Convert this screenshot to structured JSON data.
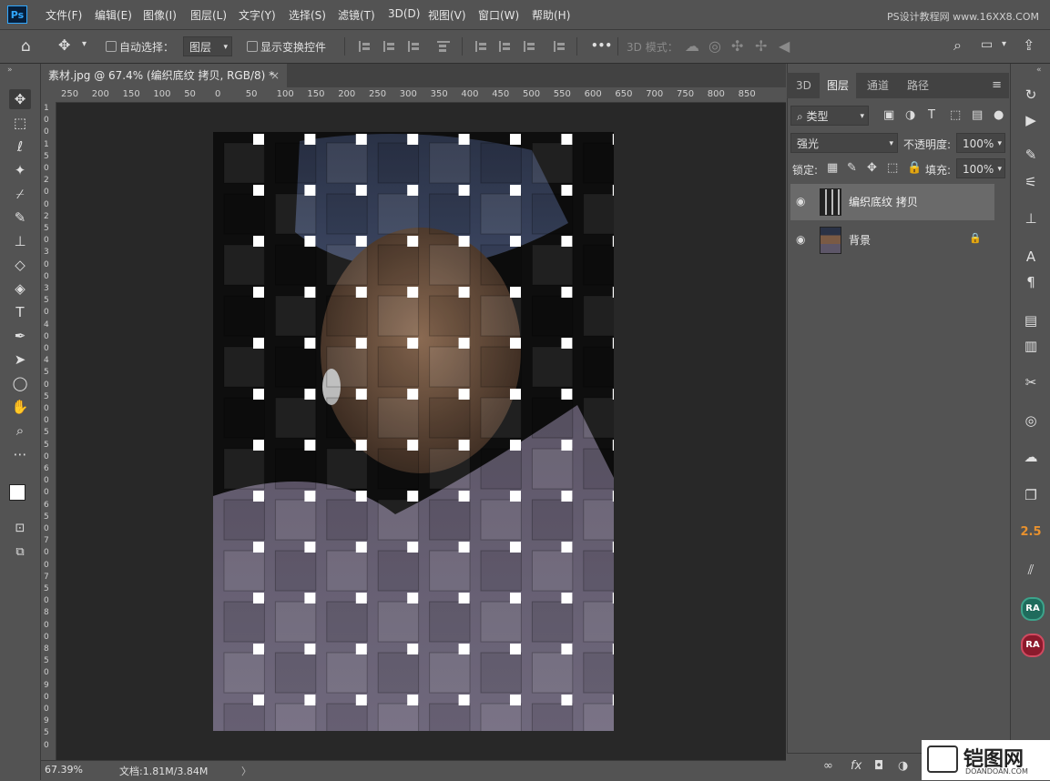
{
  "app": {
    "logo": "Ps",
    "watermark_top": "PS设计教程网  www.16XX8.COM"
  },
  "menu": [
    "文件(F)",
    "编辑(E)",
    "图像(I)",
    "图层(L)",
    "文字(Y)",
    "选择(S)",
    "滤镜(T)",
    "3D(D)",
    "视图(V)",
    "窗口(W)",
    "帮助(H)"
  ],
  "options": {
    "auto_select_label": "自动选择：",
    "auto_select_value": "图层",
    "show_transform_label": "显示变换控件",
    "more": "•••",
    "mode_3d_label": "3D 模式："
  },
  "document": {
    "tab_title": "素材.jpg @ 67.4% (编织底纹 拷贝, RGB/8) *",
    "close_glyph": "×",
    "ruler_h": [
      "250",
      "200",
      "150",
      "100",
      "50",
      "0",
      "50",
      "100",
      "150",
      "200",
      "250",
      "300",
      "350",
      "400",
      "450",
      "500",
      "550",
      "600",
      "650",
      "700",
      "750",
      "800",
      "850"
    ],
    "ruler_v": [
      "1",
      "0",
      "0",
      "1",
      "5",
      "0",
      "2",
      "0",
      "0",
      "2",
      "5",
      "0",
      "3",
      "0",
      "0",
      "3",
      "5",
      "0",
      "4",
      "0",
      "0",
      "4",
      "5",
      "0",
      "5",
      "0",
      "0",
      "5",
      "5",
      "0",
      "6",
      "0",
      "0",
      "6",
      "5",
      "0",
      "7",
      "0",
      "0",
      "7",
      "5",
      "0",
      "8",
      "0",
      "0",
      "8",
      "5",
      "0",
      "9",
      "0",
      "0",
      "9",
      "5",
      "0"
    ]
  },
  "status": {
    "zoom": "67.39%",
    "doc_size": "文档:1.81M/3.84M",
    "arrow": "〉"
  },
  "panel": {
    "tabs": [
      "3D",
      "图层",
      "通道",
      "路径"
    ],
    "active_tab": "图层",
    "filter_label": "类型",
    "blend_mode": "强光",
    "opacity_label": "不透明度:",
    "opacity_value": "100%",
    "lock_label": "锁定:",
    "fill_label": "填充:",
    "fill_value": "100%",
    "layers": [
      {
        "name": "编织底纹 拷贝",
        "selected": true,
        "locked": false
      },
      {
        "name": "背景",
        "selected": false,
        "locked": true
      }
    ]
  },
  "dock": {
    "number_badge": "2.5",
    "badge_1": "RA",
    "badge_2": "RA"
  },
  "watermark_bottom": {
    "title": "铠图网",
    "sub": "DOANDOAN.COM"
  },
  "colors": {
    "accent": "#31a8ff",
    "badge_orange": "#e8912e",
    "badge_teal": "#1f6b5c",
    "badge_red": "#8b1a2c"
  }
}
